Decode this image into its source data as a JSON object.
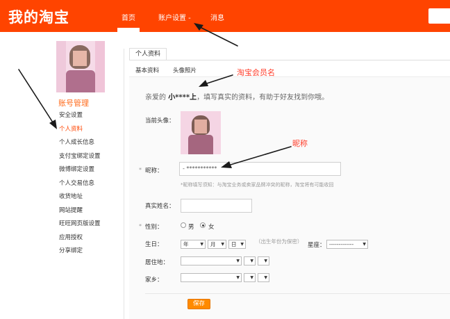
{
  "header": {
    "logo": "我的淘宝",
    "nav": {
      "home": "首页",
      "account": "账户设置 -",
      "messages": "消息"
    }
  },
  "sidebar": {
    "title": "账号管理",
    "items": [
      {
        "label": "安全设置"
      },
      {
        "label": "个人资料",
        "active": true
      },
      {
        "label": "个人成长信息"
      },
      {
        "label": "支付宝绑定设置"
      },
      {
        "label": "微博绑定设置"
      },
      {
        "label": "个人交易信息"
      },
      {
        "label": "收货地址"
      },
      {
        "label": "网站提醒"
      },
      {
        "label": "旺旺网页版设置"
      },
      {
        "label": "应用授权"
      },
      {
        "label": "分享绑定"
      }
    ]
  },
  "main": {
    "tab": "个人资料",
    "subtabs": [
      "基本资料",
      "头像照片"
    ],
    "greeting": {
      "prefix": "亲爱的",
      "username": "小****上",
      "suffix": "，填写真实的资料，有助于好友找到你哦。"
    },
    "avatar_label": "当前头像：",
    "nickname": {
      "label": "昵称：",
      "value": "- ***********",
      "hint": "*昵称填写须知：与淘宝业务或卖家品牌冲突的昵称，淘宝将有可能收回"
    },
    "realname": {
      "label": "真实姓名："
    },
    "gender": {
      "label": "性别：",
      "male": "男",
      "female": "女",
      "selected": "female"
    },
    "birthday": {
      "label": "生日：",
      "year": "年",
      "month": "月",
      "day": "日",
      "note": "（出生年份为保密）",
      "zodiac_label": "星座：",
      "zodiac_value": "-------------"
    },
    "residence": {
      "label": "居住地："
    },
    "hometown": {
      "label": "家乡："
    },
    "save_label": "保存"
  },
  "annotations": {
    "member_name": "淘宝会员名",
    "nickname": "昵称"
  },
  "colors": {
    "header_bg": "#ff4400",
    "accent": "#ff6a1a",
    "annotation": "#ff3d2a",
    "save_button": "#ff8a00"
  }
}
